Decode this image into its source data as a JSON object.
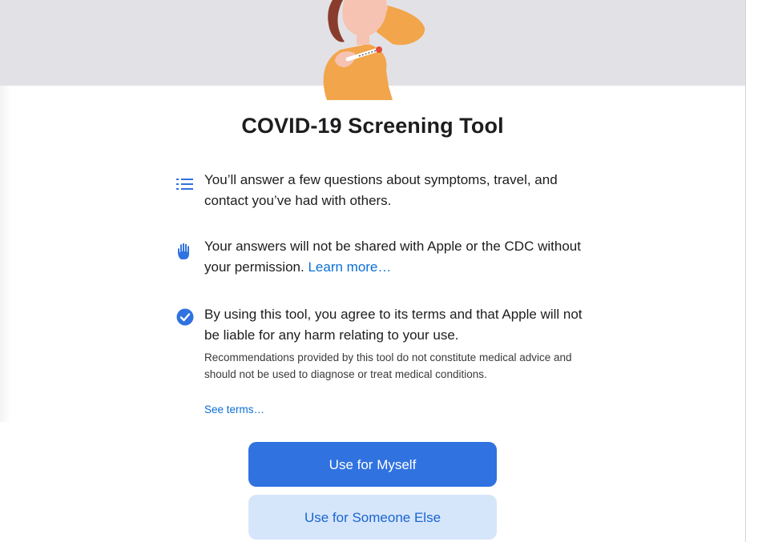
{
  "header": {
    "illustration_icon": "person-with-thermometer-illustration"
  },
  "page_title": "COVID-19 Screening Tool",
  "items": [
    {
      "icon": "list-icon",
      "text": "You’ll answer a few questions about symptoms, travel, and contact you’ve had with others."
    },
    {
      "icon": "hand-icon",
      "text": "Your answers will not be shared with Apple or the CDC without your permission.",
      "link_label": "Learn more…"
    },
    {
      "icon": "checkmark-circle-icon",
      "text": "By using this tool, you agree to its terms and that Apple will not be liable for any harm relating to your use.",
      "fine_print": "Recommendations provided by this tool do not constitute medical advice and should not be used to diagnose or treat medical conditions.",
      "link_label": "See terms…"
    }
  ],
  "buttons": {
    "primary_label": "Use for Myself",
    "secondary_label": "Use for Someone Else"
  },
  "colors": {
    "accent": "#2f72e0",
    "link": "#0a6fd6",
    "secondary_button_bg": "#d6e6fa",
    "hero_bg": "#e2e1e6"
  }
}
